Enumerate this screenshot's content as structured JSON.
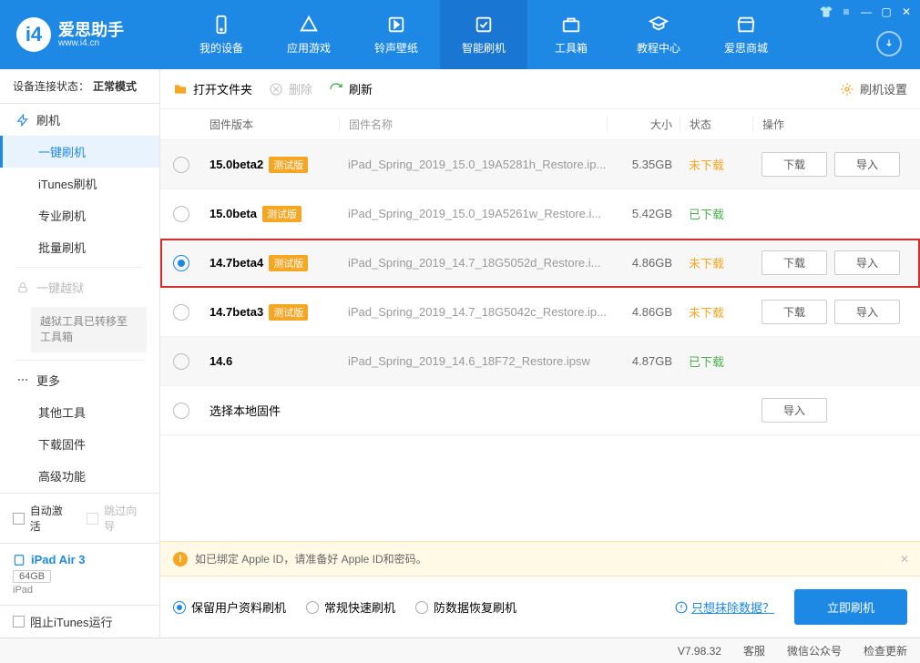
{
  "app": {
    "name": "爱思助手",
    "url": "www.i4.cn"
  },
  "nav": {
    "items": [
      {
        "label": "我的设备"
      },
      {
        "label": "应用游戏"
      },
      {
        "label": "铃声壁纸"
      },
      {
        "label": "智能刷机"
      },
      {
        "label": "工具箱"
      },
      {
        "label": "教程中心"
      },
      {
        "label": "爱思商城"
      }
    ]
  },
  "connection": {
    "label": "设备连接状态：",
    "value": "正常模式"
  },
  "sidebar": {
    "flash": {
      "head": "刷机",
      "items": [
        "一键刷机",
        "iTunes刷机",
        "专业刷机",
        "批量刷机"
      ]
    },
    "jailbreak": {
      "head": "一键越狱",
      "note": "越狱工具已转移至工具箱"
    },
    "more": {
      "head": "更多",
      "items": [
        "其他工具",
        "下载固件",
        "高级功能"
      ]
    },
    "auto_activate": "自动激活",
    "skip_guide": "跳过向导",
    "device": {
      "name": "iPad Air 3",
      "storage": "64GB",
      "type": "iPad"
    },
    "block_itunes": "阻止iTunes运行"
  },
  "toolbar": {
    "open": "打开文件夹",
    "delete": "删除",
    "refresh": "刷新",
    "settings": "刷机设置"
  },
  "table": {
    "headers": {
      "version": "固件版本",
      "name": "固件名称",
      "size": "大小",
      "status": "状态",
      "ops": "操作"
    },
    "btn_download": "下载",
    "btn_import": "导入",
    "beta_tag": "测试版",
    "local_label": "选择本地固件",
    "status_not": "未下载",
    "status_done": "已下载",
    "rows": [
      {
        "version": "15.0beta2",
        "beta": true,
        "name": "iPad_Spring_2019_15.0_19A5281h_Restore.ip...",
        "size": "5.35GB",
        "status": "not",
        "ops": [
          "download",
          "import"
        ]
      },
      {
        "version": "15.0beta",
        "beta": true,
        "name": "iPad_Spring_2019_15.0_19A5261w_Restore.i...",
        "size": "5.42GB",
        "status": "done",
        "ops": []
      },
      {
        "version": "14.7beta4",
        "beta": true,
        "name": "iPad_Spring_2019_14.7_18G5052d_Restore.i...",
        "size": "4.86GB",
        "status": "not",
        "ops": [
          "download",
          "import"
        ],
        "selected": true,
        "highlight": true
      },
      {
        "version": "14.7beta3",
        "beta": true,
        "name": "iPad_Spring_2019_14.7_18G5042c_Restore.ip...",
        "size": "4.86GB",
        "status": "not",
        "ops": [
          "download",
          "import"
        ]
      },
      {
        "version": "14.6",
        "beta": false,
        "name": "iPad_Spring_2019_14.6_18F72_Restore.ipsw",
        "size": "4.87GB",
        "status": "done",
        "ops": []
      }
    ]
  },
  "alert": "如已绑定 Apple ID，请准备好 Apple ID和密码。",
  "flash_options": {
    "opts": [
      "保留用户资料刷机",
      "常规快速刷机",
      "防数据恢复刷机"
    ],
    "erase_link": "只想抹除数据？",
    "go": "立即刷机"
  },
  "statusbar": {
    "version": "V7.98.32",
    "support": "客服",
    "wechat": "微信公众号",
    "update": "检查更新"
  }
}
